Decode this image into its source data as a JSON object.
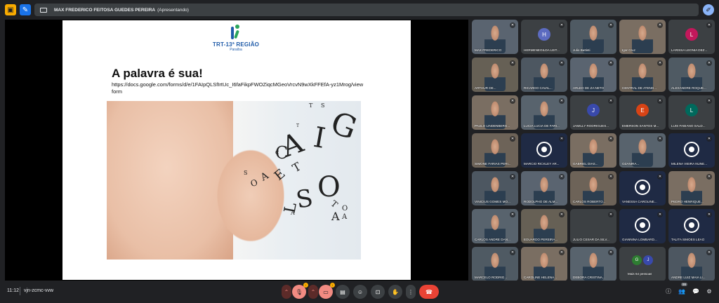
{
  "topbar": {
    "presenter_name": "MAX FREDERICO FEITOSA GUEDES PEREIRA",
    "presenter_status": "(Apresentando)",
    "left_icon_a": "present-to-all-icon",
    "left_icon_b": "edit-icon"
  },
  "slide": {
    "logo_title": "TRT-13ª REGIÃO",
    "logo_sub": "Paraíba",
    "title": "A palavra é sua!",
    "url": "https://docs.google.com/forms/d/e/1FAIpQLSfIrtUc_I6faFikpFWOZiqcMGeoVrcvN9wXkFFEfA-yz1Mrog/viewform"
  },
  "participants": [
    {
      "name": "MAX FREDERICO",
      "type": "video"
    },
    {
      "name": "HERMENEGILDA LEIT...",
      "type": "avatar",
      "initial": "H",
      "color": "#5c6bc0"
    },
    {
      "name": "Julio Battisti",
      "type": "video"
    },
    {
      "name": "Igor Cruz",
      "type": "video"
    },
    {
      "name": "LARISSA LEONIA DEZ...",
      "type": "avatar",
      "initial": "L",
      "color": "#c2185b"
    },
    {
      "name": "ARTHUR DE...",
      "type": "video"
    },
    {
      "name": "RICARDO CAVAL...",
      "type": "video"
    },
    {
      "name": "ARLEO DE ZA NETO",
      "type": "video"
    },
    {
      "name": "CENTRAL DE ATEND...",
      "type": "video"
    },
    {
      "name": "ALEXANDRE ROQUE...",
      "type": "video"
    },
    {
      "name": "PAULO LINDENBERG...",
      "type": "video"
    },
    {
      "name": "LUCIA LUCIA DE FARI...",
      "type": "video"
    },
    {
      "name": "JAMILLY RODRIGUES...",
      "type": "avatar",
      "initial": "J",
      "color": "#3949ab"
    },
    {
      "name": "EMERSON SANTOS M...",
      "type": "avatar",
      "initial": "E",
      "color": "#d84315"
    },
    {
      "name": "LUIS FABIANO SALD...",
      "type": "avatar",
      "initial": "L",
      "color": "#00695c"
    },
    {
      "name": "SIMONE FARIAS PERI...",
      "type": "video"
    },
    {
      "name": "MARCIO RICKLEY AR...",
      "type": "film"
    },
    {
      "name": "GABRIEL DIAS...",
      "type": "video"
    },
    {
      "name": "OZANIRA...",
      "type": "video"
    },
    {
      "name": "MILENA VIEIRA NUNE...",
      "type": "film"
    },
    {
      "name": "VINICIUS GOMES MO...",
      "type": "video"
    },
    {
      "name": "RODOLPHO DE ALM...",
      "type": "video"
    },
    {
      "name": "CARLOS ROBERTO...",
      "type": "video"
    },
    {
      "name": "VANESSA CAROLINE...",
      "type": "film"
    },
    {
      "name": "PEDRO HENRIQUE...",
      "type": "video"
    },
    {
      "name": "CARLOS ANDRE DAN...",
      "type": "video"
    },
    {
      "name": "EDUARDO PEREIRA...",
      "type": "video"
    },
    {
      "name": "JULIO CESAR DA SILV...",
      "type": "plain"
    },
    {
      "name": "GIANNINA LOMBARD...",
      "type": "film"
    },
    {
      "name": "TALITA SIMOES LEAO",
      "type": "film"
    },
    {
      "name": "MARCELO RODRIG...",
      "type": "video"
    },
    {
      "name": "CAROLINE HELENA...",
      "type": "video"
    },
    {
      "name": "DEBORA CRISTINA...",
      "type": "video"
    },
    {
      "name": "Mais 64 pessoas",
      "type": "more"
    },
    {
      "name": "ANDRE LUIZ MAIA LI...",
      "type": "video"
    }
  ],
  "more_avatars": [
    {
      "initial": "G",
      "color": "#2e7d32"
    },
    {
      "initial": "J",
      "color": "#3949ab"
    }
  ],
  "bottombar": {
    "time": "11:12",
    "meeting_code": "vjn-zcmc-vvw",
    "participant_count": "99",
    "mic_badge": "!",
    "cam_badge": "!"
  }
}
